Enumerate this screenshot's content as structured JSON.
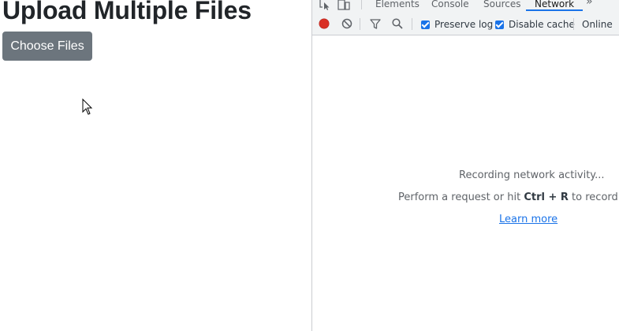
{
  "page": {
    "title": "Upload Multiple Files",
    "choose_button": "Choose Files"
  },
  "devtools": {
    "tabs": [
      {
        "label": "Elements",
        "active": false
      },
      {
        "label": "Console",
        "active": false
      },
      {
        "label": "Sources",
        "active": false
      },
      {
        "label": "Network",
        "active": true
      }
    ],
    "more_tabs": "»",
    "toolbar": {
      "preserve_log": {
        "label": "Preserve log",
        "checked": true
      },
      "disable_cache": {
        "label": "Disable cache",
        "checked": true
      },
      "throttling": "Online"
    },
    "empty_state": {
      "recording": "Recording network activity...",
      "hint_prefix": "Perform a request or hit ",
      "shortcut_ctrl": "Ctrl",
      "shortcut_plus": " + ",
      "shortcut_key": "R",
      "hint_suffix": " to record the",
      "learn_more": "Learn more"
    },
    "colors": {
      "record": "#d93025",
      "accent": "#1a73e8"
    }
  }
}
